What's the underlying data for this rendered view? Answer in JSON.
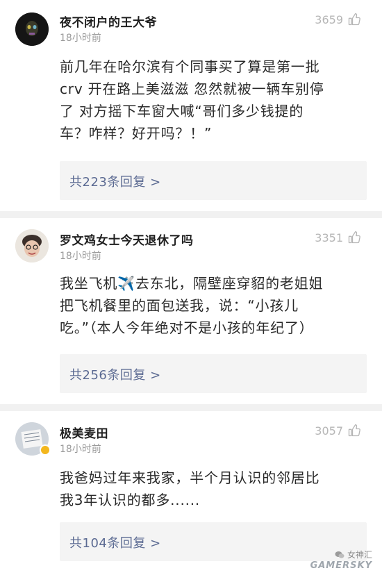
{
  "comments": [
    {
      "username": "夜不闭户的王大爷",
      "time": "18小时前",
      "likes": "3659",
      "lines": [
        "前几年在哈尔滨有个同事买了算是第一批",
        "crv  开在路上美滋滋  忽然就被一辆车别停",
        "了  对方摇下车窗大喊“哥们多少钱提的",
        "车？咋样？好开吗？！”"
      ],
      "replies": "共223条回复 >"
    },
    {
      "username": "罗文鸡女士今天退休了吗",
      "time": "18小时前",
      "likes": "3351",
      "lines": [
        "我坐飞机✈️去东北，隔壁座穿貂的老姐姐",
        "把飞机餐里的面包送我，说：“小孩儿",
        "吃。”（本人今年绝对不是小孩的年纪了）"
      ],
      "replies": "共256条回复 >"
    },
    {
      "username": "极美麦田",
      "time": "18小时前",
      "likes": "3057",
      "lines": [
        "我爸妈过年来我家，半个月认识的邻居比",
        "我3年认识的都多......"
      ],
      "replies": "共104条回复 >"
    }
  ],
  "watermark": {
    "account": "女神汇",
    "brand": "GAMERSKY"
  }
}
